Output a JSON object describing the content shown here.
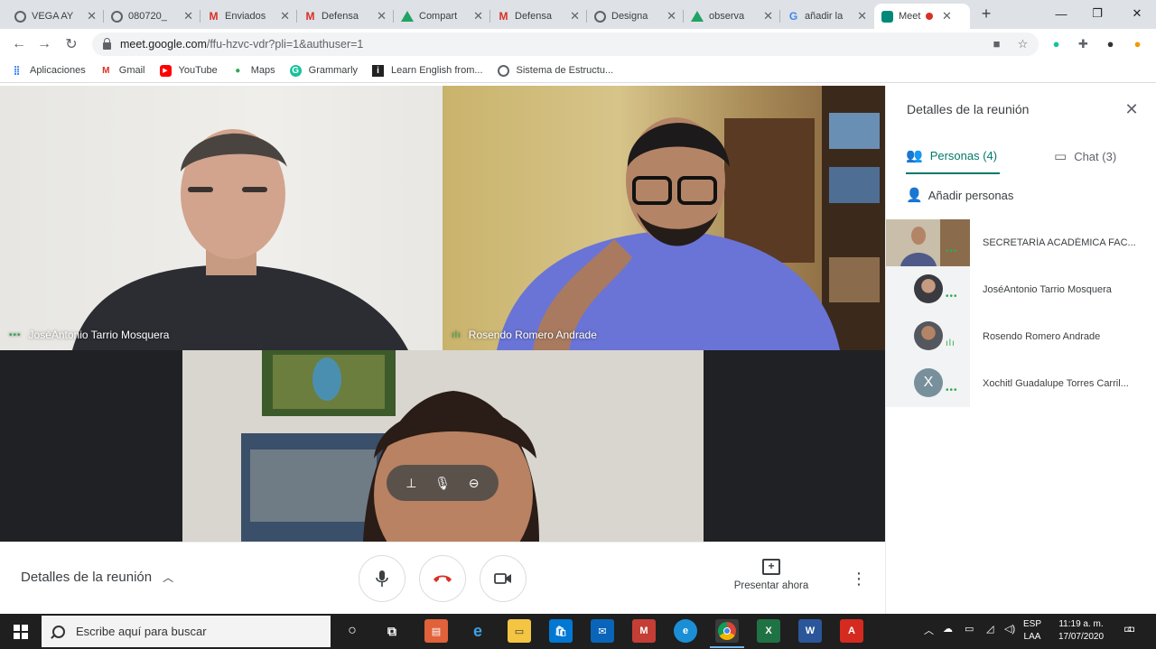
{
  "browser": {
    "tabs": [
      {
        "label": "VEGA AY",
        "icon": "globe-icon"
      },
      {
        "label": "080720_",
        "icon": "globe-icon"
      },
      {
        "label": "Enviados",
        "icon": "gmail-icon"
      },
      {
        "label": "Defensa",
        "icon": "gmail-icon"
      },
      {
        "label": "Compart",
        "icon": "drive-icon"
      },
      {
        "label": "Defensa",
        "icon": "gmail-icon"
      },
      {
        "label": "Designa",
        "icon": "globe-icon"
      },
      {
        "label": "observa",
        "icon": "drive-icon"
      },
      {
        "label": "añadir la",
        "icon": "google-icon"
      },
      {
        "label": "Meet",
        "icon": "meet-icon",
        "active": true,
        "recording": true
      }
    ],
    "url_host": "meet.google.com",
    "url_path": "/ffu-hzvc-vdr?pli=1&authuser=1",
    "bookmarks": [
      {
        "label": "Aplicaciones",
        "icon": "apps-grid-icon"
      },
      {
        "label": "Gmail",
        "icon": "gmail-icon"
      },
      {
        "label": "YouTube",
        "icon": "youtube-icon"
      },
      {
        "label": "Maps",
        "icon": "maps-pin-icon"
      },
      {
        "label": "Grammarly",
        "icon": "grammarly-icon"
      },
      {
        "label": "Learn English from...",
        "icon": "bookmark-site-icon"
      },
      {
        "label": "Sistema de Estructu...",
        "icon": "globe-icon"
      }
    ]
  },
  "meeting": {
    "tiles": [
      {
        "name": "JoséAntonio Tarrio Mosquera"
      },
      {
        "name": "Rosendo Romero Andrade"
      },
      {
        "name": ""
      }
    ],
    "bottom": {
      "details_label": "Detalles de la reunión",
      "present_label": "Presentar ahora"
    }
  },
  "panel": {
    "title": "Detalles de la reunión",
    "tab_people": "Personas (4)",
    "tab_chat": "Chat (3)",
    "add_people": "Añadir personas",
    "participants": [
      {
        "name": "SECRETARÍA ACADÉMICA FAC...",
        "avatar": "video-thumb"
      },
      {
        "name": "JoséAntonio Tarrio Mosquera",
        "avatar": "photo"
      },
      {
        "name": "Rosendo Romero Andrade",
        "avatar": "photo"
      },
      {
        "name": "Xochitl Guadalupe Torres Carril...",
        "avatar": "letter",
        "initial": "X"
      }
    ]
  },
  "taskbar": {
    "search_placeholder": "Escribe aquí para buscar",
    "lang_line1": "ESP",
    "lang_line2": "LAA",
    "time": "11:19 a. m.",
    "date": "17/07/2020",
    "notification_count": "4"
  },
  "colors": {
    "meet_accent": "#00796b",
    "hangup_red": "#d93025",
    "audio_green": "#34a853"
  }
}
